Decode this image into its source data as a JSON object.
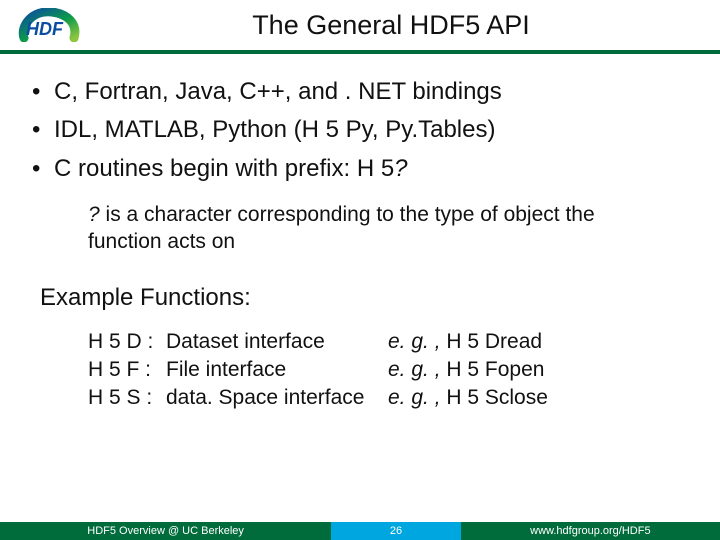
{
  "title": "The General HDF5 API",
  "bullets": [
    {
      "text": "C, Fortran, Java, C++, and . NET bindings"
    },
    {
      "text": "IDL, MATLAB, Python (H 5 Py, Py.Tables)"
    },
    {
      "prefix": "C routines begin with prefix: H 5",
      "italic": "?"
    }
  ],
  "subnote": {
    "lead_italic": "?",
    "rest": " is a character corresponding to the type of object the function acts on"
  },
  "examples_heading": "Example Functions:",
  "functions": [
    {
      "code": "H 5 D :",
      "desc": "Dataset interface",
      "eg": "e. g. ,",
      "name": "H 5 Dread"
    },
    {
      "code": "H 5 F :",
      "desc": "File interface",
      "eg": "e. g. ,",
      "name": "H 5 Fopen"
    },
    {
      "code": "H 5 S :",
      "desc": "data. Space interface",
      "eg": "e. g. ,",
      "name": "H 5 Sclose"
    }
  ],
  "footer": {
    "left": "HDF5 Overview @ UC Berkeley",
    "center": "26",
    "right": "www.hdfgroup.org/HDF5"
  },
  "logo_alt": "HDF"
}
